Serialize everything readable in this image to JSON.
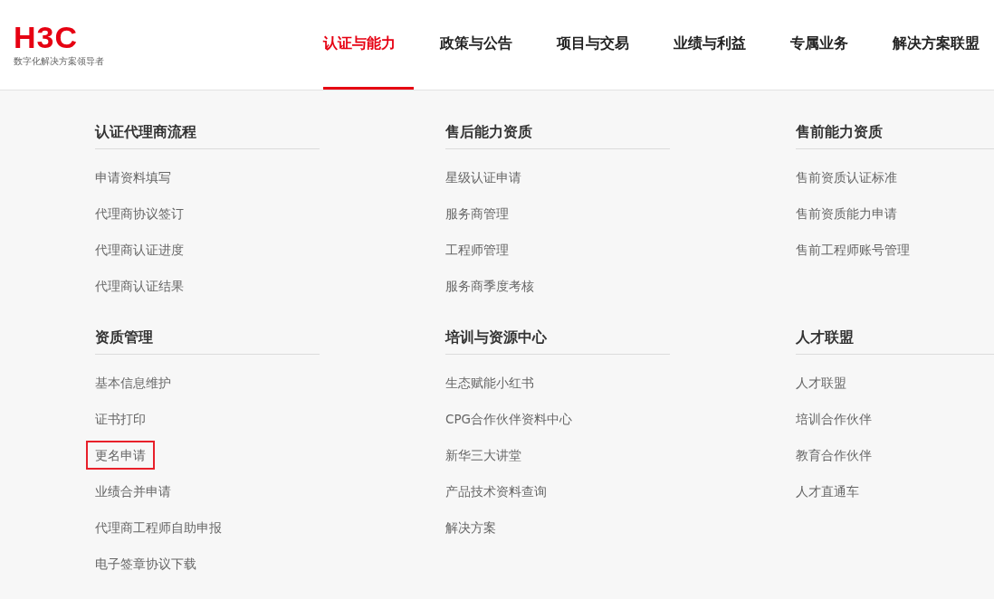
{
  "header": {
    "logo": "H3C",
    "tagline": "数字化解决方案领导者",
    "nav": [
      {
        "label": "认证与能力",
        "selected": true
      },
      {
        "label": "政策与公告",
        "selected": false
      },
      {
        "label": "项目与交易",
        "selected": false
      },
      {
        "label": "业绩与利益",
        "selected": false
      },
      {
        "label": "专属业务",
        "selected": false
      },
      {
        "label": "解决方案联盟",
        "selected": false
      }
    ]
  },
  "menu": {
    "rows": [
      {
        "sections": [
          {
            "title": "认证代理商流程",
            "items": [
              {
                "label": "申请资料填写",
                "highlighted": false
              },
              {
                "label": "代理商协议签订",
                "highlighted": false
              },
              {
                "label": "代理商认证进度",
                "highlighted": false
              },
              {
                "label": "代理商认证结果",
                "highlighted": false
              }
            ]
          },
          {
            "title": "售后能力资质",
            "items": [
              {
                "label": "星级认证申请",
                "highlighted": false
              },
              {
                "label": "服务商管理",
                "highlighted": false
              },
              {
                "label": "工程师管理",
                "highlighted": false
              },
              {
                "label": "服务商季度考核",
                "highlighted": false
              }
            ]
          },
          {
            "title": "售前能力资质",
            "items": [
              {
                "label": "售前资质认证标准",
                "highlighted": false
              },
              {
                "label": "售前资质能力申请",
                "highlighted": false
              },
              {
                "label": "售前工程师账号管理",
                "highlighted": false
              }
            ]
          }
        ]
      },
      {
        "sections": [
          {
            "title": "资质管理",
            "items": [
              {
                "label": "基本信息维护",
                "highlighted": false
              },
              {
                "label": "证书打印",
                "highlighted": false
              },
              {
                "label": "更名申请",
                "highlighted": true
              },
              {
                "label": "业绩合并申请",
                "highlighted": false
              },
              {
                "label": "代理商工程师自助申报",
                "highlighted": false
              },
              {
                "label": "电子签章协议下载",
                "highlighted": false
              }
            ]
          },
          {
            "title": "培训与资源中心",
            "items": [
              {
                "label": "生态赋能小红书",
                "highlighted": false
              },
              {
                "label": "CPG合作伙伴资料中心",
                "highlighted": false
              },
              {
                "label": "新华三大讲堂",
                "highlighted": false
              },
              {
                "label": "产品技术资料查询",
                "highlighted": false
              },
              {
                "label": "解决方案",
                "highlighted": false
              }
            ]
          },
          {
            "title": "人才联盟",
            "items": [
              {
                "label": "人才联盟",
                "highlighted": false
              },
              {
                "label": "培训合作伙伴",
                "highlighted": false
              },
              {
                "label": "教育合作伙伴",
                "highlighted": false
              },
              {
                "label": "人才直通车",
                "highlighted": false
              }
            ]
          }
        ]
      }
    ]
  }
}
